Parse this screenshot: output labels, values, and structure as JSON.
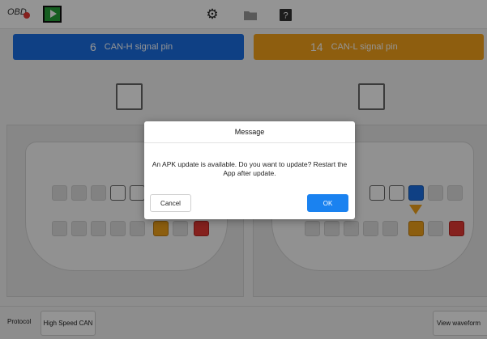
{
  "topbar": {
    "obd_label": "OBD",
    "icons": {
      "obd_status": "red-dot-icon",
      "run": "play-icon",
      "settings": "gear-icon",
      "files": "folder-icon",
      "help": "help-icon"
    }
  },
  "pins": {
    "can_h": {
      "number": "6",
      "label": "CAN-H signal pin",
      "color": "#1a6fe3"
    },
    "can_l": {
      "number": "14",
      "label": "CAN-L signal pin",
      "color": "#f5a31a"
    }
  },
  "bottombar": {
    "protocol_label": "Protocol",
    "protocol_value": "High Speed CAN",
    "view_waveform_label": "View waveform"
  },
  "dialog": {
    "title": "Message",
    "message": "An APK update is available. Do you want to update? Restart the App after update.",
    "cancel_label": "Cancel",
    "ok_label": "OK"
  },
  "colors": {
    "accent_blue": "#1a82f0",
    "pin_orange": "#f2a21a",
    "pin_red": "#e53935",
    "play_green": "#27a23a"
  }
}
